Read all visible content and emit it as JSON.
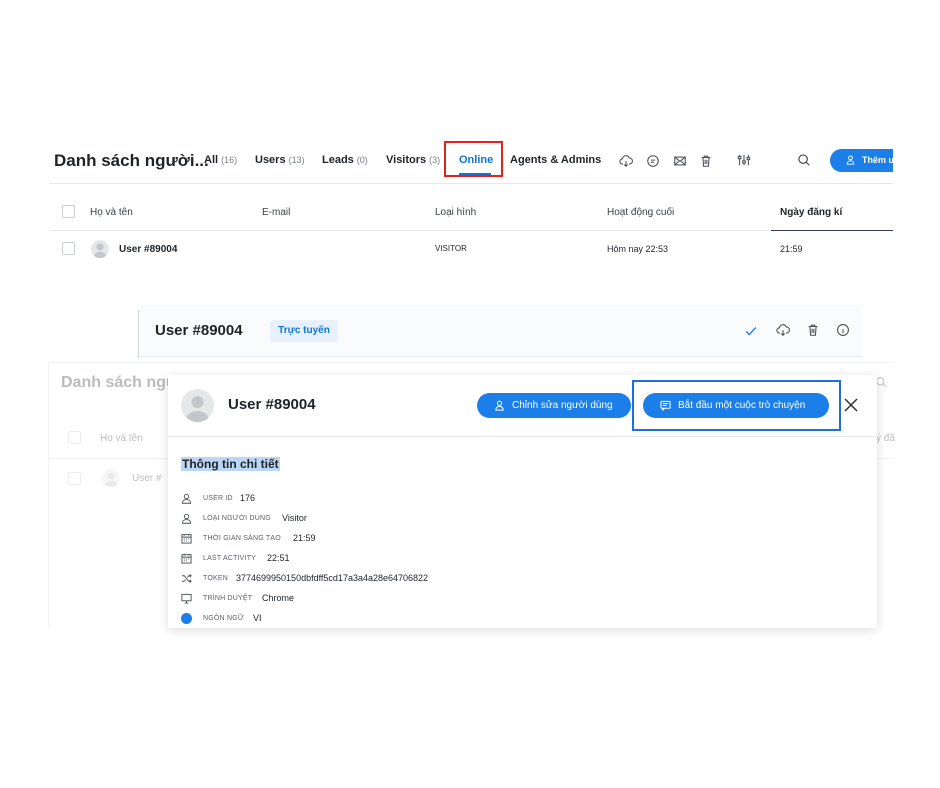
{
  "top": {
    "title": "Danh sách người...",
    "tabs": [
      {
        "label": "All",
        "count": "(16)"
      },
      {
        "label": "Users",
        "count": "(13)"
      },
      {
        "label": "Leads",
        "count": "(0)"
      },
      {
        "label": "Visitors",
        "count": "(3)"
      },
      {
        "label": "Online",
        "count": ""
      },
      {
        "label": "Agents & Admins",
        "count": ""
      }
    ],
    "toolbar_icons": [
      "cloud-download-icon",
      "chat-icon",
      "mail-icon",
      "trash-icon",
      "filter-sliders-icon",
      "search-icon"
    ],
    "add_button_label": "Thêm u",
    "columns": [
      "Họ và tên",
      "E-mail",
      "Loại hình",
      "Hoạt động cuối",
      "Ngày đăng kí"
    ],
    "rows": [
      {
        "name": "User #89004",
        "email": "",
        "type": "VISITOR",
        "last_activity": "Hôm nay 22:53",
        "registered": "21:59"
      }
    ]
  },
  "mid": {
    "title": "User #89004",
    "badge": "Trực tuyến",
    "icons": [
      "check-icon",
      "cloud-download-icon",
      "trash-icon",
      "info-icon"
    ]
  },
  "background": {
    "title": "Danh sách ngư",
    "column": "Họ và tên",
    "row_name": "User #",
    "partial_header": "ý đă"
  },
  "modal": {
    "title": "User #89004",
    "edit_button": "Chỉnh sửa người dùng",
    "start_button": "Bắt đầu một cuộc trò chuyện",
    "section_title": "Thông tin chi tiết",
    "details": [
      {
        "label": "USER ID",
        "value": "176",
        "icon": "user-icon"
      },
      {
        "label": "LOẠI NGƯỜI DÙNG",
        "value": "Visitor",
        "icon": "user-icon"
      },
      {
        "label": "THỜI GIAN SÁNG TẠO",
        "value": "21:59",
        "icon": "calendar-icon"
      },
      {
        "label": "LAST ACTIVITY",
        "value": "22:51",
        "icon": "calendar-icon"
      },
      {
        "label": "TOKEN",
        "value": "3774699950150dbfdff5cd17a3a4a28e64706822",
        "icon": "shuffle-icon"
      },
      {
        "label": "TRÌNH DUYỆT",
        "value": "Chrome",
        "icon": "monitor-icon"
      },
      {
        "label": "NGÔN NGỮ",
        "value": "VI",
        "icon": "language-icon"
      }
    ]
  },
  "colors": {
    "accent": "#1c7ee8",
    "highlight_red": "#e1221b",
    "highlight_blue": "#1d6fe0",
    "selection": "#bcd6f5"
  }
}
